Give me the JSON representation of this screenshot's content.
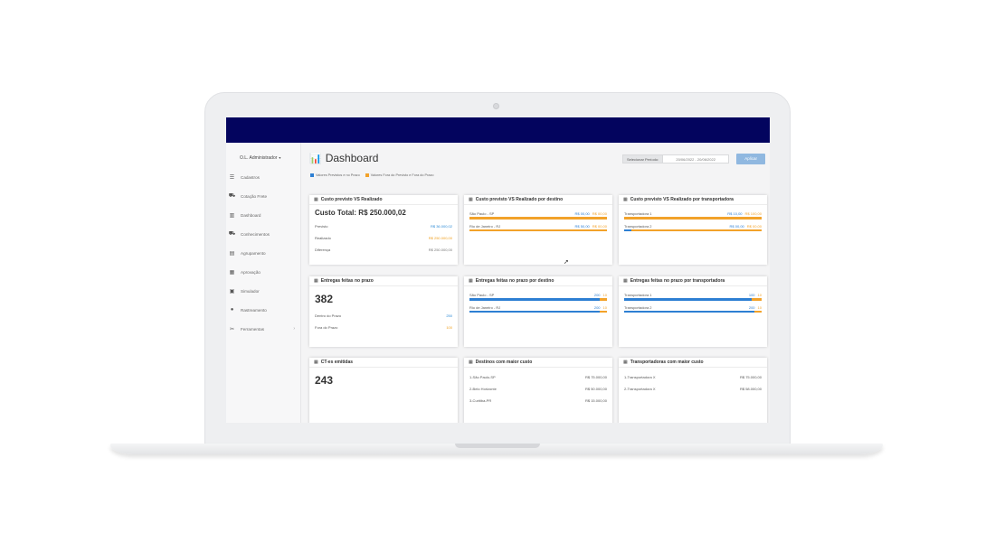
{
  "sidebar": {
    "user": "O.L. Administrador",
    "items": [
      {
        "label": "Cadastros",
        "icon": "list-icon",
        "glyph": "☰"
      },
      {
        "label": "Cotação Frete",
        "icon": "truck-icon",
        "glyph": "⛟"
      },
      {
        "label": "Dashboard",
        "icon": "chart-icon",
        "glyph": "▥"
      },
      {
        "label": "Conhecimentos",
        "icon": "truck-icon",
        "glyph": "⛟"
      },
      {
        "label": "Agrupamento",
        "icon": "clipboard-icon",
        "glyph": "▤"
      },
      {
        "label": "Aprovação",
        "icon": "file-check-icon",
        "glyph": "▦"
      },
      {
        "label": "Simulador",
        "icon": "calculator-icon",
        "glyph": "▣"
      },
      {
        "label": "Rastreamento",
        "icon": "map-marker-icon",
        "glyph": "●"
      },
      {
        "label": "Ferramentas",
        "icon": "wrench-icon",
        "glyph": "✂"
      }
    ]
  },
  "header": {
    "title": "Dashboard",
    "period_label": "Selecionar Período:",
    "period_value": "20/06/2022 - 20/06/2022",
    "apply_button": "Aplicar"
  },
  "legend": {
    "in_time": "Valores Previstos e no Prazo",
    "out_time": "Valores Fora do Previsto e Fora do Prazo",
    "colors": {
      "in_time": "#2d7fd3",
      "out_time": "#f2a22a"
    }
  },
  "cards": {
    "cost_total": {
      "title": "Custo previsto VS Realizado",
      "headline": "Custo Total: R$ 250.000,02",
      "rows": [
        {
          "label": "Previsto",
          "value": "R$ 36.000,02"
        },
        {
          "label": "Realizado",
          "value": "R$ 250.000,00"
        },
        {
          "label": "Diferença",
          "value": "R$ 250.000,00"
        }
      ]
    },
    "cost_by_destination": {
      "title": "Custo previsto VS Realizado por destino",
      "rows": [
        {
          "label": "São Paulo - SP",
          "blue": "R$ 00,00",
          "orange": "R$ 00,00",
          "blue_frac": 0.0,
          "orange_frac": 1.0
        },
        {
          "label": "Rio de Janeiro - RJ",
          "blue": "R$ 50,00",
          "orange": "R$ 00,00",
          "blue_frac": 0.0,
          "orange_frac": 1.0
        }
      ]
    },
    "cost_by_carrier": {
      "title": "Custo previsto VS Realizado por transportadora",
      "rows": [
        {
          "label": "Transportadora 1",
          "blue": "R$ 10,00",
          "orange": "R$ 100,00",
          "blue_frac": 0.0,
          "orange_frac": 1.0
        },
        {
          "label": "Transportadora 2",
          "blue": "R$ 00,00",
          "orange": "R$ 00,00",
          "blue_frac": 0.05,
          "orange_frac": 1.0
        }
      ]
    },
    "deliveries": {
      "title": "Entregas feitas no prazo",
      "count": "382",
      "rows": [
        {
          "label": "Dentro do Prazo",
          "value": "250"
        },
        {
          "label": "Fora do Prazo",
          "value": "100"
        }
      ]
    },
    "deliveries_by_destination": {
      "title": "Entregas feitas no prazo por destino",
      "rows": [
        {
          "label": "São Paulo - SP",
          "blue": "200",
          "orange": "10",
          "blue_frac": 0.95,
          "orange_frac": 1.0
        },
        {
          "label": "Rio de Janeiro - RJ",
          "blue": "200",
          "orange": "10",
          "blue_frac": 0.95,
          "orange_frac": 1.0
        }
      ]
    },
    "deliveries_by_carrier": {
      "title": "Entregas feitas no prazo por transportadora",
      "rows": [
        {
          "label": "Transportadora 1",
          "blue": "100",
          "orange": "10",
          "blue_frac": 0.93,
          "orange_frac": 1.0
        },
        {
          "label": "Transportadora 2",
          "blue": "200",
          "orange": "10",
          "blue_frac": 0.95,
          "orange_frac": 1.0
        }
      ]
    },
    "cte": {
      "title": "CT-es emitidas",
      "count": "243"
    },
    "top_destinations": {
      "title": "Destinos com maior custo",
      "rows": [
        {
          "label": "1-São Paulo-SP",
          "value": "R$ 75.000,00"
        },
        {
          "label": "2-Belo Horizonte",
          "value": "R$ 50.000,00"
        },
        {
          "label": "3-Curitiba-PR",
          "value": "R$ 15.000,00"
        }
      ]
    },
    "top_carriers": {
      "title": "Transportadoras com maior custo",
      "rows": [
        {
          "label": "1-Transportadora X",
          "value": "R$ 75.000,00"
        },
        {
          "label": "2-Transportadora X",
          "value": "R$ 58.000,00"
        }
      ]
    }
  }
}
